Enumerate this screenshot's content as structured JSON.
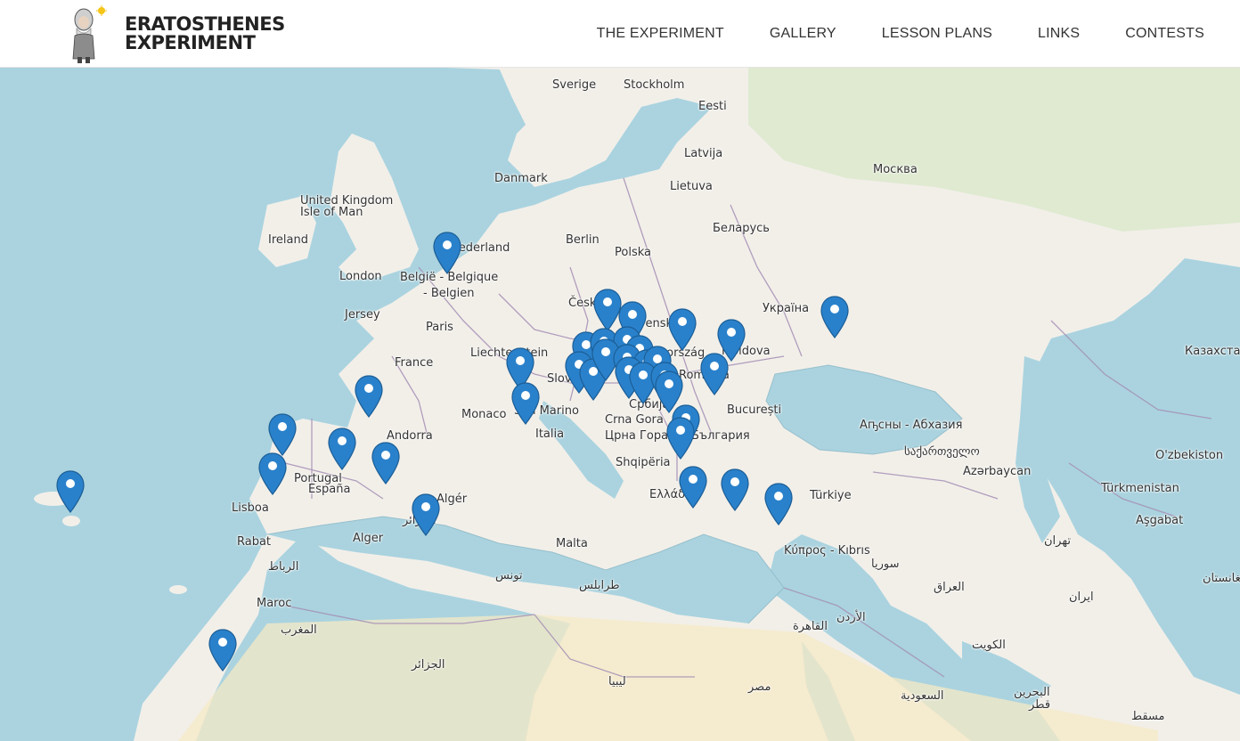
{
  "header": {
    "logo_line1": "ERATOSTHENES",
    "logo_line2": "EXPERIMENT",
    "nav": [
      "THE EXPERIMENT",
      "GALLERY",
      "LESSON PLANS",
      "LINKS",
      "CONTESTS"
    ]
  },
  "map": {
    "labels": [
      "Sverige",
      "Stockholm",
      "Eesti",
      "Latvija",
      "Lietuva",
      "Москва",
      "Danmark",
      "United Kingdom",
      "Isle of Man",
      "Ireland",
      "Nederland",
      "Berlin",
      "Polska",
      "Беларусь",
      "London",
      "België - Belgique",
      "- Belgien",
      "Jersey",
      "Paris",
      "Česko",
      "Slovensko",
      "Україна",
      "Liechtenstein",
      "France",
      "Magyarország",
      "Moldova",
      "Казахстан",
      "Slovenija",
      "România",
      "Monaco",
      "San Marino",
      "Србија",
      "București",
      "Andorra",
      "Italia",
      "Crna Gora",
      "Црна Гора",
      "България",
      "Аҧсны - Абхазия",
      "საქართველო",
      "Portugal",
      "España",
      "Shqipëria",
      "Azərbaycan",
      "O'zbekiston",
      "Lisboa",
      "Algér",
      "Ελλάδα",
      "Türkiye",
      "Türkmenistan",
      "Aşgabat",
      "Rabat",
      "Alger",
      "الجزائر",
      "Malta",
      "Κύπρος - Kıbrıs",
      "تهران",
      "الرباط",
      "تونس",
      "سوريا",
      "Maroc",
      "طرابلس",
      "العراق",
      "ایران",
      "المغرب",
      "الأردن",
      "القاهرة",
      "الكويت",
      "الجزائر",
      "ليبيا",
      "مصر",
      "السعودية",
      "البحرين",
      "قطر",
      "مسقط",
      "افغانستان"
    ],
    "marker_count": 35
  },
  "colors": {
    "sea": "#aad3df",
    "land": "#f2efe9",
    "desert": "#f5e9c6",
    "forest": "#d7e8c6",
    "border": "#a58fb5",
    "marker": "#2a81cb"
  },
  "icons": {
    "marker": "map-pin-icon",
    "capital": "star-icon"
  }
}
